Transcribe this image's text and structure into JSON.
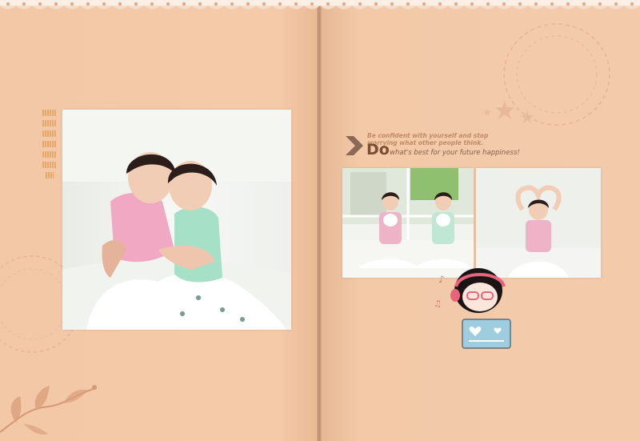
{
  "album": {
    "left_page": {
      "photo_label": "Two girls hugging",
      "vertical_decoration_rows": 7
    },
    "right_page": {
      "quote_line1": "Be confident with yourself and stop",
      "quote_line2": "worrying what other people think.",
      "quote_big": "Do",
      "quote_line3": "what's best for your future happiness!",
      "photo1_label": "Girls holding bowls",
      "photo2_label": "Girl heart pose"
    }
  },
  "colors": {
    "page_bg": "#f3c9a8",
    "accent_brown": "#7a4e34",
    "quote_tan": "#c08a64",
    "lace": "#e6a37a"
  },
  "icons": [
    "lace-border",
    "chevron-arrow-icon",
    "music-note-icon",
    "star-icon",
    "heart-icon",
    "cartoon-girl-icon",
    "floral-vine-icon"
  ]
}
